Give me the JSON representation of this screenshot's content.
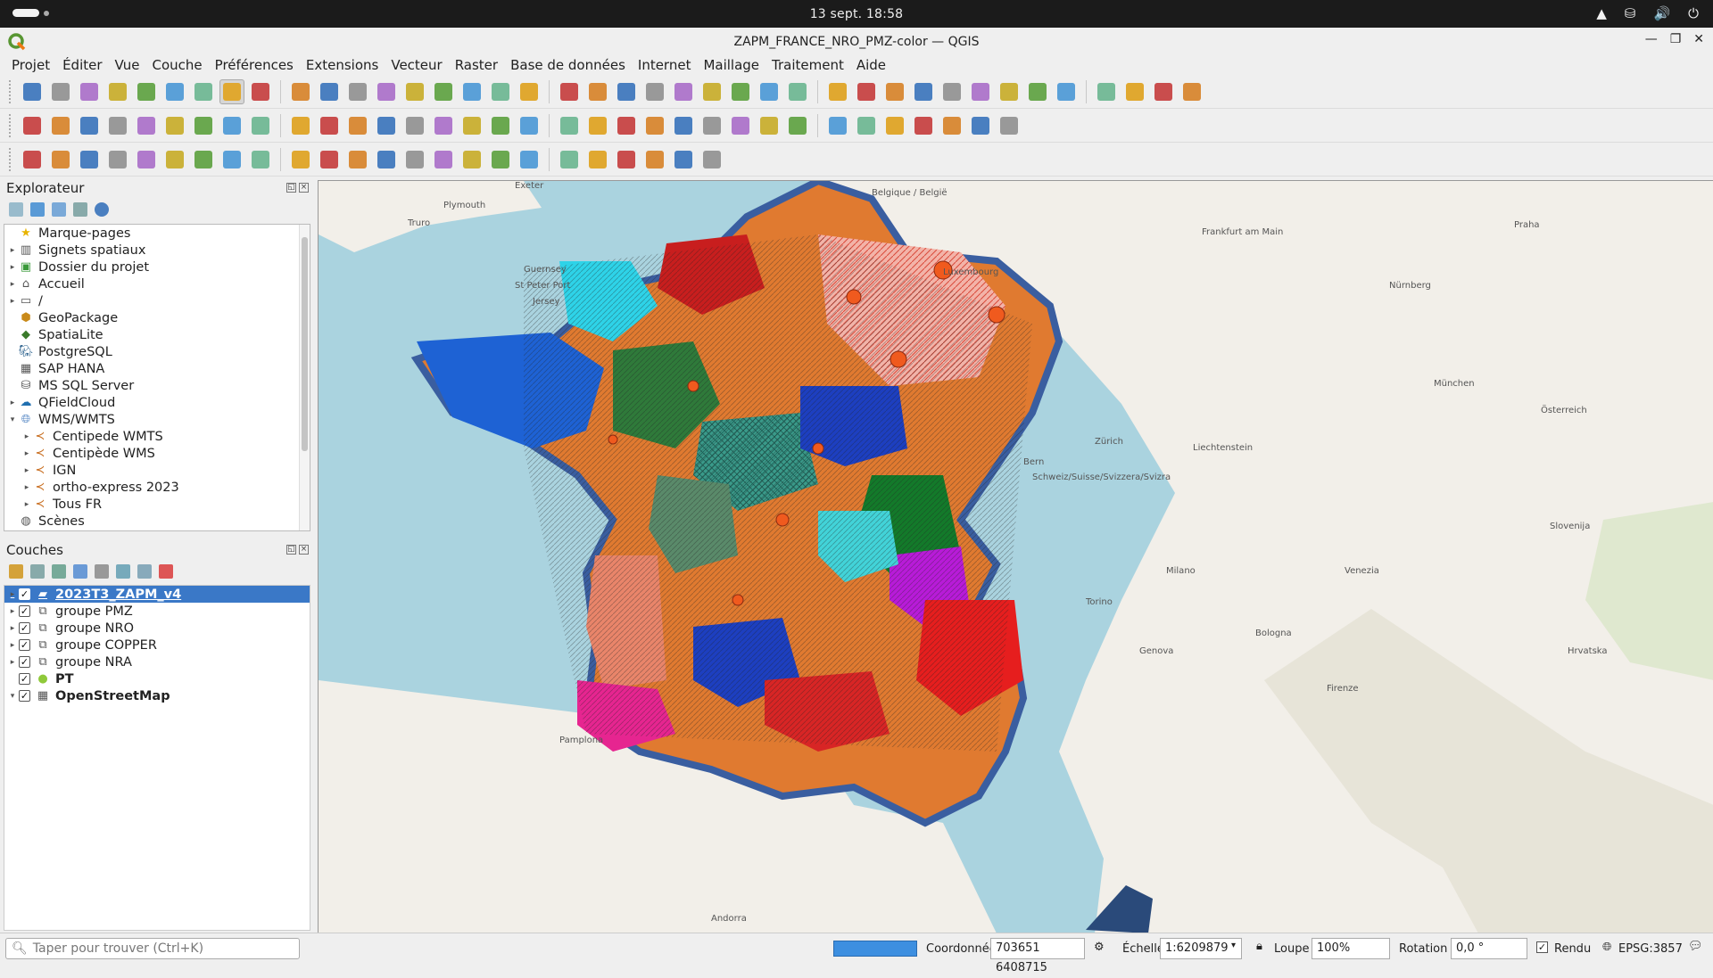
{
  "system": {
    "clock": "13 sept.  18:58"
  },
  "window": {
    "title": "ZAPM_FRANCE_NRO_PMZ-color — QGIS"
  },
  "menu": [
    "Projet",
    "Éditer",
    "Vue",
    "Couche",
    "Préférences",
    "Extensions",
    "Vecteur",
    "Raster",
    "Base de données",
    "Internet",
    "Maillage",
    "Traitement",
    "Aide"
  ],
  "browser": {
    "title": "Explorateur",
    "items": [
      {
        "label": "Marque-pages",
        "icon": "star-icon",
        "level": 0,
        "expand": ""
      },
      {
        "label": "Signets spatiaux",
        "icon": "bookmark-icon",
        "level": 0,
        "expand": "▸"
      },
      {
        "label": "Dossier du projet",
        "icon": "project-folder-icon",
        "level": 0,
        "expand": "▸"
      },
      {
        "label": "Accueil",
        "icon": "home-icon",
        "level": 0,
        "expand": "▸"
      },
      {
        "label": "/",
        "icon": "folder-icon",
        "level": 0,
        "expand": "▸"
      },
      {
        "label": "GeoPackage",
        "icon": "geopackage-icon",
        "level": 0,
        "expand": ""
      },
      {
        "label": "SpatiaLite",
        "icon": "spatialite-icon",
        "level": 0,
        "expand": ""
      },
      {
        "label": "PostgreSQL",
        "icon": "postgresql-icon",
        "level": 0,
        "expand": ""
      },
      {
        "label": "SAP HANA",
        "icon": "sap-hana-icon",
        "level": 0,
        "expand": ""
      },
      {
        "label": "MS SQL Server",
        "icon": "mssql-icon",
        "level": 0,
        "expand": ""
      },
      {
        "label": "QFieldCloud",
        "icon": "qfieldcloud-icon",
        "level": 0,
        "expand": "▸"
      },
      {
        "label": "WMS/WMTS",
        "icon": "wms-icon",
        "level": 0,
        "expand": "▾"
      },
      {
        "label": "Centipede WMTS",
        "icon": "wms-connection-icon",
        "level": 1,
        "expand": "▸"
      },
      {
        "label": "Centipède WMS",
        "icon": "wms-connection-icon",
        "level": 1,
        "expand": "▸"
      },
      {
        "label": "IGN",
        "icon": "wms-connection-icon",
        "level": 1,
        "expand": "▸"
      },
      {
        "label": "ortho-express 2023",
        "icon": "wms-connection-icon",
        "level": 1,
        "expand": "▸"
      },
      {
        "label": "Tous FR",
        "icon": "wms-connection-icon",
        "level": 1,
        "expand": "▸"
      },
      {
        "label": "Scènes",
        "icon": "scenes-icon",
        "level": 0,
        "expand": ""
      }
    ]
  },
  "layers": {
    "title": "Couches",
    "items": [
      {
        "label": "2023T3_ZAPM_v4",
        "icon": "polygon-layer-icon",
        "checked": "✓",
        "selected": true,
        "bold": true
      },
      {
        "label": "groupe PMZ",
        "icon": "group-icon",
        "checked": "✓",
        "selected": false,
        "bold": false
      },
      {
        "label": "groupe NRO",
        "icon": "group-icon",
        "checked": "✓",
        "selected": false,
        "bold": false
      },
      {
        "label": "groupe COPPER",
        "icon": "group-icon",
        "checked": "✓",
        "selected": false,
        "bold": false
      },
      {
        "label": "groupe NRA",
        "icon": "group-icon",
        "checked": "✓",
        "selected": false,
        "bold": false
      },
      {
        "label": "PT",
        "icon": "point-layer-icon",
        "checked": "✓",
        "selected": false,
        "bold": true
      },
      {
        "label": "OpenStreetMap",
        "icon": "xyz-tile-icon",
        "checked": "✓",
        "selected": false,
        "bold": true
      }
    ]
  },
  "map_labels": [
    "Belgique / België",
    "Plymouth",
    "Exeter",
    "Truro",
    "Guernsey",
    "St Peter Port",
    "Jersey",
    "Frankfurt am Main",
    "Praha",
    "Nürnberg",
    "München",
    "Österreich",
    "Zürich",
    "Bern",
    "Schweiz/Suisse/Svizzera/Svizra",
    "Liechtenstein",
    "Milano",
    "Genova",
    "Venezia",
    "Firenze",
    "Slovenija",
    "Hrvatska",
    "Luxembourg",
    "Pamplona",
    "Andorra",
    "Bologna",
    "Torino"
  ],
  "status": {
    "locator_placeholder": "Taper pour trouver (Ctrl+K)",
    "coord_label": "Coordonnée",
    "coord_value": "703651  6408715",
    "scale_label": "Échelle",
    "scale_value": "1:6209879",
    "magnifier_label": "Loupe",
    "magnifier_value": "100%",
    "rotation_label": "Rotation",
    "rotation_value": "0,0 °",
    "render_label": "Rendu",
    "render_checked": "✓",
    "crs": "EPSG:3857"
  },
  "colors": {
    "selection": "#3a78c7",
    "sea": "#aad3df",
    "land": "#f2efe9"
  }
}
